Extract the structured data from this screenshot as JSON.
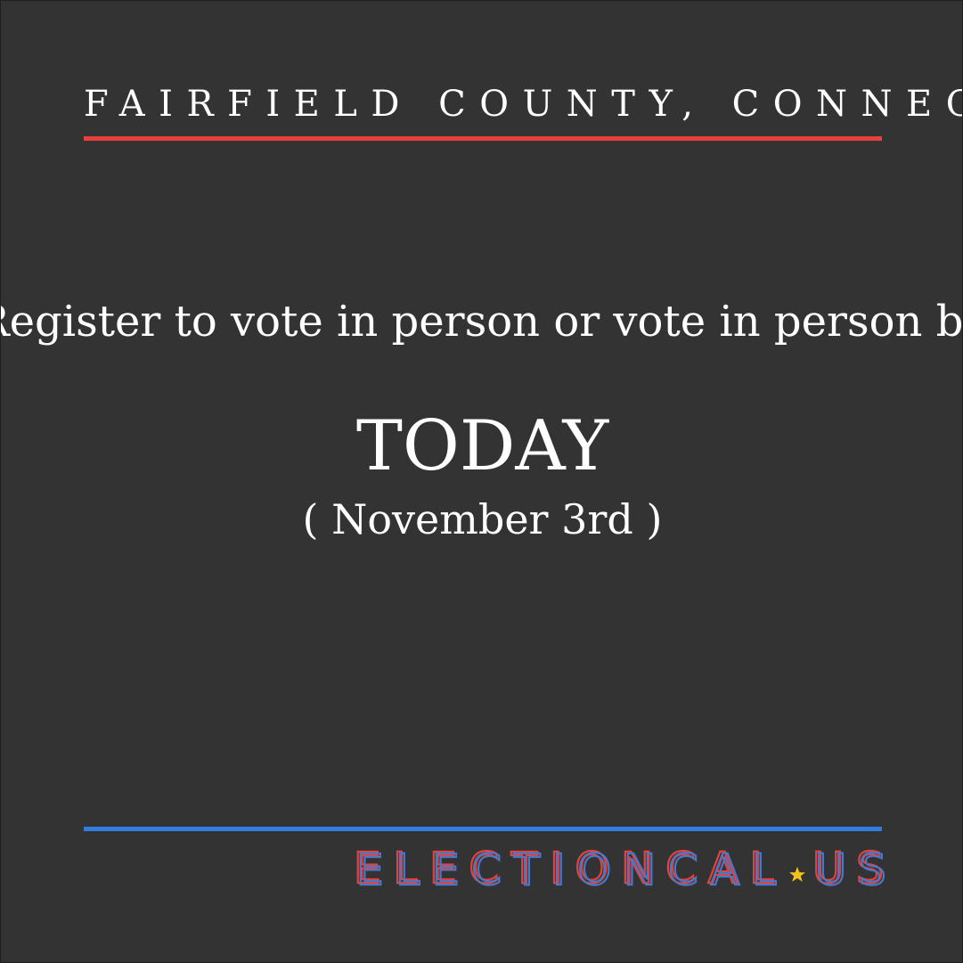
{
  "header": {
    "location": "FAIRFIELD COUNTY, CONNECTICUT"
  },
  "main": {
    "message": "Register to vote in person or vote in person by",
    "headline": "TODAY",
    "date": "( November 3rd )"
  },
  "footer": {
    "brand_name": "ELECTIONCAL",
    "brand_tld": "US",
    "brand_icon": "star-icon"
  },
  "colors": {
    "background": "#333333",
    "red": "#e8403a",
    "blue": "#2f7de1",
    "brand_blue": "#4a78c8",
    "star": "#f2c21b",
    "text": "#ffffff"
  }
}
